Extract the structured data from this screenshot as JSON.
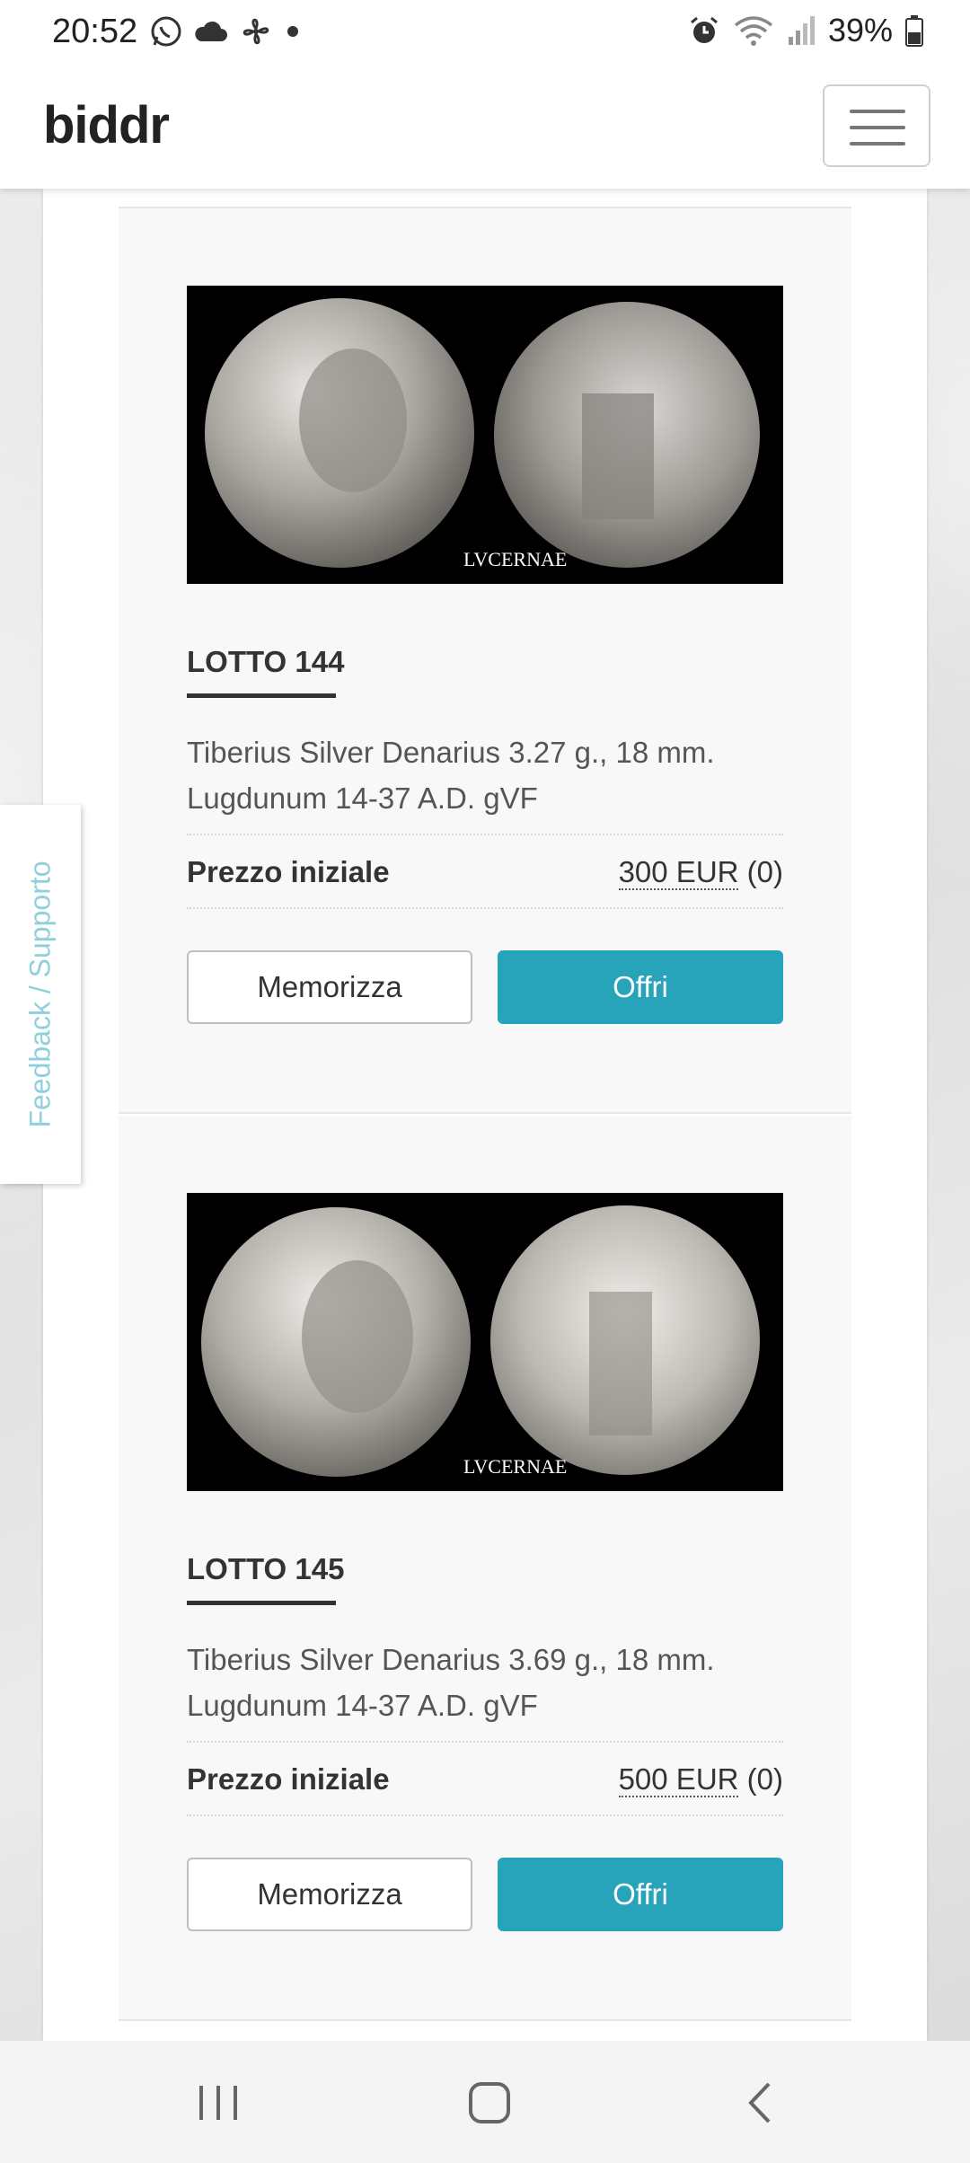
{
  "status_bar": {
    "time": "20:52",
    "icons_left": [
      "whatsapp-icon",
      "cloud-icon",
      "fan-icon",
      "dot-icon"
    ],
    "icons_right": [
      "alarm-icon",
      "wifi-icon",
      "signal-icon",
      "battery-icon"
    ],
    "battery_text": "39%"
  },
  "header": {
    "logo": "biddr",
    "menu_icon": "hamburger-menu-icon"
  },
  "feedback": {
    "label": "Feedback / Supporto"
  },
  "lots": [
    {
      "title": "LOTTO 144",
      "description": "Tiberius Silver Denarius 3.27 g., 18 mm. Lugdunum 14-37 A.D. gVF",
      "price_label": "Prezzo iniziale",
      "price_amount": "300 EUR",
      "bid_count": "(0)",
      "save_label": "Memorizza",
      "offer_label": "Offri",
      "watermark": "LVCERNAE"
    },
    {
      "title": "LOTTO 145",
      "description": "Tiberius Silver Denarius 3.69 g., 18 mm. Lugdunum 14-37 A.D. gVF",
      "price_label": "Prezzo iniziale",
      "price_amount": "500 EUR",
      "bid_count": "(0)",
      "save_label": "Memorizza",
      "offer_label": "Offri",
      "watermark": "LVCERNAE"
    }
  ],
  "colors": {
    "accent": "#27a3ba",
    "feedback_text": "#8fd0dc"
  },
  "nav_bar": {
    "buttons": [
      "recent-apps-icon",
      "home-icon",
      "back-icon"
    ]
  }
}
